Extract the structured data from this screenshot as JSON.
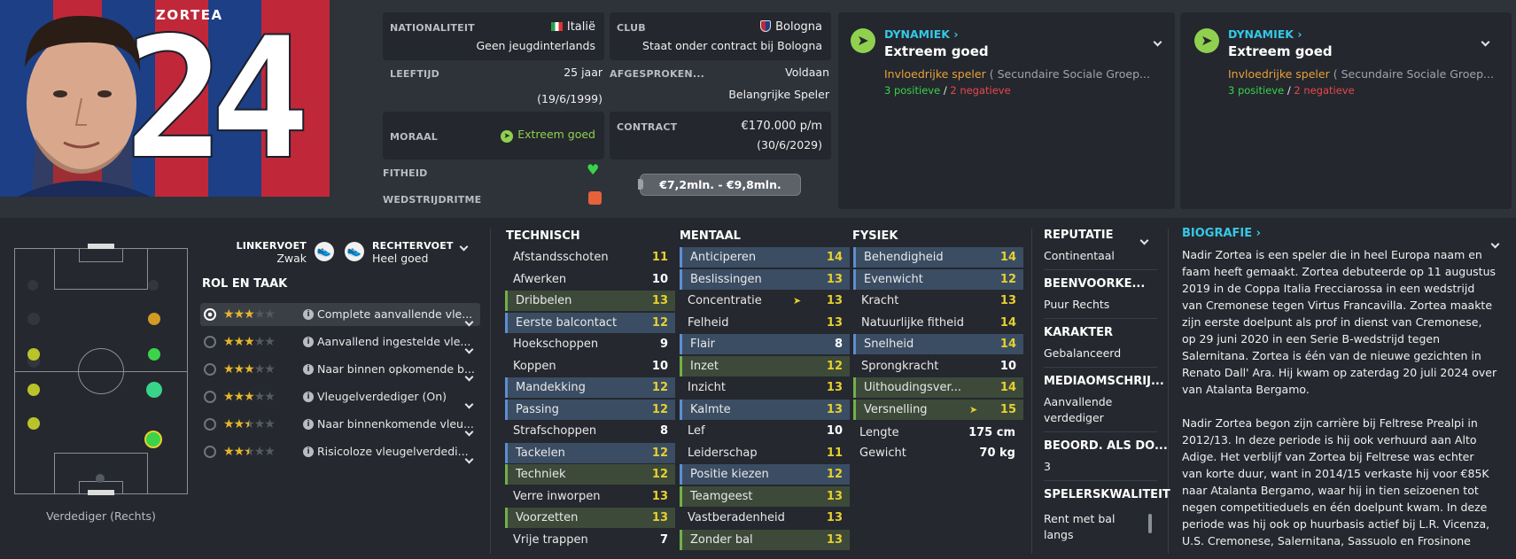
{
  "player": {
    "name": "ZORTEA",
    "number": "24"
  },
  "info": {
    "nationality_label": "NATIONALITEIT",
    "nationality": "Italië",
    "nationality_sub": "Geen jeugdinterlands",
    "club_label": "CLUB",
    "club": "Bologna",
    "club_sub": "Staat onder contract bij Bologna",
    "age_label": "LEEFTIJD",
    "age": "25 jaar",
    "dob": "(19/6/1999)",
    "agreed_label": "AFGESPROKEN...",
    "agreed": "Voldaan",
    "agreed_sub": "Belangrijke Speler",
    "morale_label": "MORAAL",
    "morale": "Extreem goed",
    "contract_label": "CONTRACT",
    "contract": "€170.000 p/m",
    "contract_end": "(30/6/2029)",
    "fitness_label": "FITHEID",
    "rhythm_label": "WEDSTRIJDRITME",
    "value": "€7,2mln. - €9,8mln."
  },
  "dynamics": [
    {
      "title": "DYNAMIEK",
      "level": "Extreem goed",
      "influence": "Invloedrijke speler",
      "group": "( Secundaire Sociale Groep...",
      "pos": "3 positieve",
      "sep": "/",
      "neg": "2 negatieve"
    },
    {
      "title": "DYNAMIEK",
      "level": "Extreem goed",
      "influence": "Invloedrijke speler",
      "group": "( Secundaire Sociale Groep...",
      "pos": "3 positieve",
      "sep": "/",
      "neg": "2 negatieve"
    }
  ],
  "feet": {
    "left_label": "LINKERVOET",
    "left": "Zwak",
    "right_label": "RECHTERVOET",
    "right": "Heel goed"
  },
  "roles_title": "ROL EN TAAK",
  "roles": [
    {
      "name": "Complete aanvallende vle...",
      "stars": 3
    },
    {
      "name": "Aanvallend ingestelde vle...",
      "stars": 3
    },
    {
      "name": "Naar binnen opkomende b...",
      "stars": 3
    },
    {
      "name": "Vleugelverdediger (On)",
      "stars": 3
    },
    {
      "name": "Naar binnenkomende vleu...",
      "stars": 2.5
    },
    {
      "name": "Risicoloze vleugelverdedi...",
      "stars": 2.5
    }
  ],
  "position_caption": "Verdediger (Rechts)",
  "technical": {
    "title": "TECHNISCH",
    "rows": [
      {
        "n": "Afstandsschoten",
        "v": "11",
        "hl": "none"
      },
      {
        "n": "Afwerken",
        "v": "10",
        "hl": "none"
      },
      {
        "n": "Dribbelen",
        "v": "13",
        "hl": "green"
      },
      {
        "n": "Eerste balcontact",
        "v": "12",
        "hl": "blue"
      },
      {
        "n": "Hoekschoppen",
        "v": "9",
        "hl": "none"
      },
      {
        "n": "Koppen",
        "v": "10",
        "hl": "none"
      },
      {
        "n": "Mandekking",
        "v": "12",
        "hl": "blue"
      },
      {
        "n": "Passing",
        "v": "12",
        "hl": "blue"
      },
      {
        "n": "Strafschoppen",
        "v": "8",
        "hl": "none"
      },
      {
        "n": "Tackelen",
        "v": "12",
        "hl": "blue"
      },
      {
        "n": "Techniek",
        "v": "12",
        "hl": "green"
      },
      {
        "n": "Verre inworpen",
        "v": "13",
        "hl": "none"
      },
      {
        "n": "Voorzetten",
        "v": "13",
        "hl": "green"
      },
      {
        "n": "Vrije trappen",
        "v": "7",
        "hl": "none"
      }
    ]
  },
  "mental": {
    "title": "MENTAAL",
    "rows": [
      {
        "n": "Anticiperen",
        "v": "14",
        "hl": "blue"
      },
      {
        "n": "Beslissingen",
        "v": "13",
        "hl": "blue"
      },
      {
        "n": "Concentratie",
        "v": "13",
        "hl": "none",
        "arrow": true
      },
      {
        "n": "Felheid",
        "v": "13",
        "hl": "none"
      },
      {
        "n": "Flair",
        "v": "8",
        "hl": "blue"
      },
      {
        "n": "Inzet",
        "v": "12",
        "hl": "green"
      },
      {
        "n": "Inzicht",
        "v": "13",
        "hl": "none"
      },
      {
        "n": "Kalmte",
        "v": "13",
        "hl": "blue"
      },
      {
        "n": "Lef",
        "v": "10",
        "hl": "none"
      },
      {
        "n": "Leiderschap",
        "v": "11",
        "hl": "none"
      },
      {
        "n": "Positie kiezen",
        "v": "12",
        "hl": "blue"
      },
      {
        "n": "Teamgeest",
        "v": "13",
        "hl": "green"
      },
      {
        "n": "Vastberadenheid",
        "v": "13",
        "hl": "none"
      },
      {
        "n": "Zonder bal",
        "v": "13",
        "hl": "green"
      }
    ]
  },
  "physical": {
    "title": "FYSIEK",
    "rows": [
      {
        "n": "Behendigheid",
        "v": "14",
        "hl": "blue"
      },
      {
        "n": "Evenwicht",
        "v": "12",
        "hl": "blue"
      },
      {
        "n": "Kracht",
        "v": "13",
        "hl": "none"
      },
      {
        "n": "Natuurlijke fitheid",
        "v": "14",
        "hl": "none"
      },
      {
        "n": "Snelheid",
        "v": "14",
        "hl": "blue"
      },
      {
        "n": "Sprongkracht",
        "v": "10",
        "hl": "none"
      },
      {
        "n": "Uithoudingsver...",
        "v": "14",
        "hl": "green"
      },
      {
        "n": "Versnelling",
        "v": "15",
        "hl": "green",
        "arrow": true
      }
    ],
    "length_label": "Lengte",
    "length": "175 cm",
    "weight_label": "Gewicht",
    "weight": "70 kg"
  },
  "side": {
    "rep_label": "REPUTATIE",
    "rep": "Continentaal",
    "foot_label": "BEENVOORKE...",
    "foot": "Puur Rechts",
    "char_label": "KARAKTER",
    "char": "Gebalanceerd",
    "media_label": "MEDIAOMSCHRIJ...",
    "media1": "Aanvallende",
    "media2": "verdediger",
    "rating_label": "BEOORD. ALS DO...",
    "rating": "3",
    "quality_label": "SPELERSKWALITEIT",
    "quality1": "Rent met bal",
    "quality2": "langs"
  },
  "bio": {
    "title": "BIOGRAFIE",
    "p1": [
      "Nadir Zortea is een speler die in heel Europa naam en",
      "faam heeft gemaakt. Zortea debuteerde op 11 augustus",
      "2019 in de Coppa Italia Frecciarossa in een wedstrijd",
      "van Cremonese tegen Virtus Francavilla. Zortea maakte",
      "zijn eerste doelpunt als prof in dienst van Cremonese,",
      "op 29 juni 2020 in een Serie B-wedstrijd tegen",
      "Salernitana. Zortea is één van de nieuwe gezichten in",
      "Renato Dall' Ara. Hij kwam op zaterdag 20 juli 2024 over",
      "van Atalanta Bergamo."
    ],
    "p2": [
      "Nadir Zortea begon zijn carrière bij Feltrese Prealpi in",
      "2012/13. In deze periode is hij ook verhuurd aan Alto",
      "Adige. Het verblijf van Zortea bij Feltrese was echter",
      "van korte duur, want in 2014/15 verkaste hij voor €85K",
      "naar Atalanta Bergamo, waar hij in tien seizoenen tot",
      "negen competitieduels en één doelpunt kwam. In deze",
      "periode was hij ook op huurbasis actief bij L.R. Vicenza,",
      "U.S. Cremonese, Salernitana, Sassuolo en Frosinone"
    ]
  },
  "colors": {
    "accent": "#35c8e6",
    "green": "#3ad34a",
    "red": "#e8474d",
    "orange": "#e8a03a",
    "yellow": "#e6d02f"
  }
}
